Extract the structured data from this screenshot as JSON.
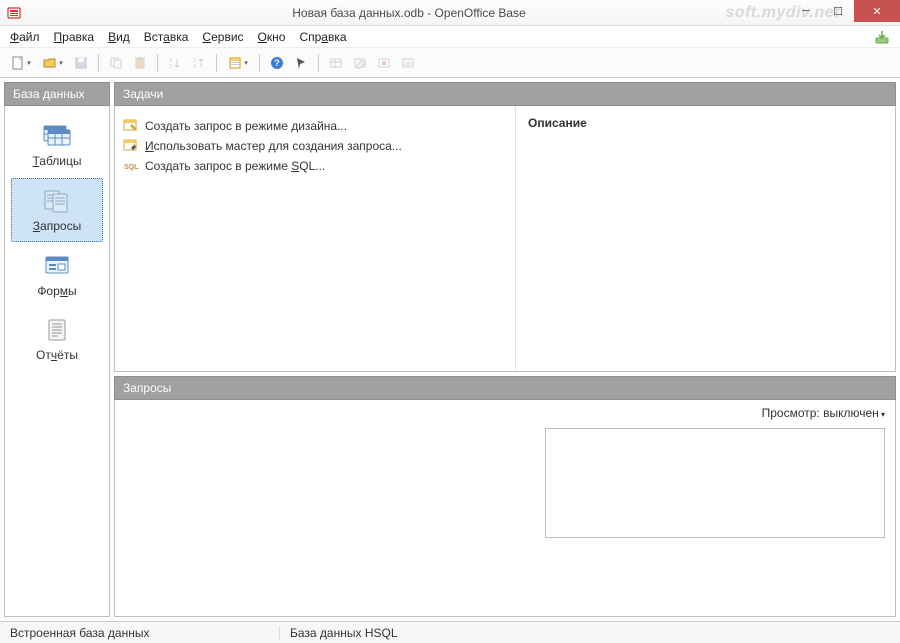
{
  "window": {
    "title": "Новая база данных.odb - OpenOffice Base",
    "watermark": "soft.mydiv.net"
  },
  "menu": {
    "file": "Файл",
    "edit": "Правка",
    "view": "Вид",
    "insert": "Вставка",
    "tools": "Сервис",
    "window": "Окно",
    "help": "Справка"
  },
  "sidebar": {
    "header": "База данных",
    "items": [
      {
        "label": "Таблицы",
        "selected": false
      },
      {
        "label": "Запросы",
        "selected": true
      },
      {
        "label": "Формы",
        "selected": false
      },
      {
        "label": "Отчёты",
        "selected": false
      }
    ]
  },
  "tasks": {
    "header": "Задачи",
    "items": [
      "Создать запрос в режиме дизайна...",
      "Использовать мастер для создания запроса...",
      "Создать запрос в режиме SQL..."
    ],
    "description_header": "Описание"
  },
  "queries": {
    "header": "Запросы",
    "view_label": "Просмотр: выключен"
  },
  "status": {
    "left": "Встроенная база данных",
    "db": "База данных HSQL"
  }
}
